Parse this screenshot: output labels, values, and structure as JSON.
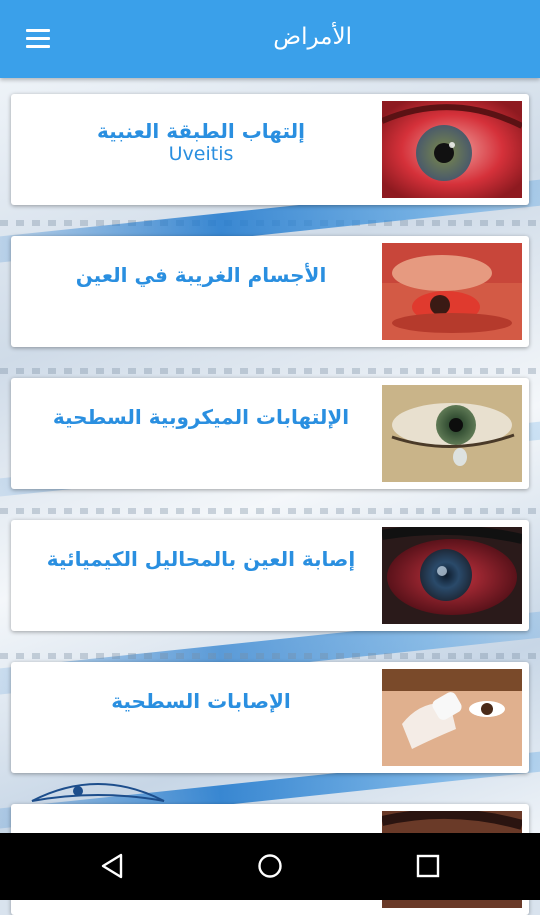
{
  "app_bar": {
    "title": "الأمراض",
    "menu_icon": "hamburger-menu-icon"
  },
  "items": [
    {
      "title": "إلتهاب الطبقة العنبية",
      "subtitle": "Uveitis",
      "image": "red-inflamed-eye"
    },
    {
      "title": "الأجسام الغريبة في العين",
      "subtitle": "",
      "image": "eyelid-pulled-foreign-body"
    },
    {
      "title": "الإلتهابات الميكروبية السطحية",
      "subtitle": "",
      "image": "green-eye-tear"
    },
    {
      "title": "إصابة العين بالمحاليل الكيميائية",
      "subtitle": "",
      "image": "chemical-burn-eye"
    },
    {
      "title": "الإصابات السطحية",
      "subtitle": "",
      "image": "child-eye-bandage"
    },
    {
      "title": "",
      "subtitle": "",
      "image": "partially-visible-eye"
    }
  ],
  "colors": {
    "app_bar": "#3aa0ea",
    "accent_text": "#2a8fe0",
    "nav_bar": "#000000"
  },
  "nav": {
    "back": "back-icon",
    "home": "home-icon",
    "recent": "recent-apps-icon"
  }
}
